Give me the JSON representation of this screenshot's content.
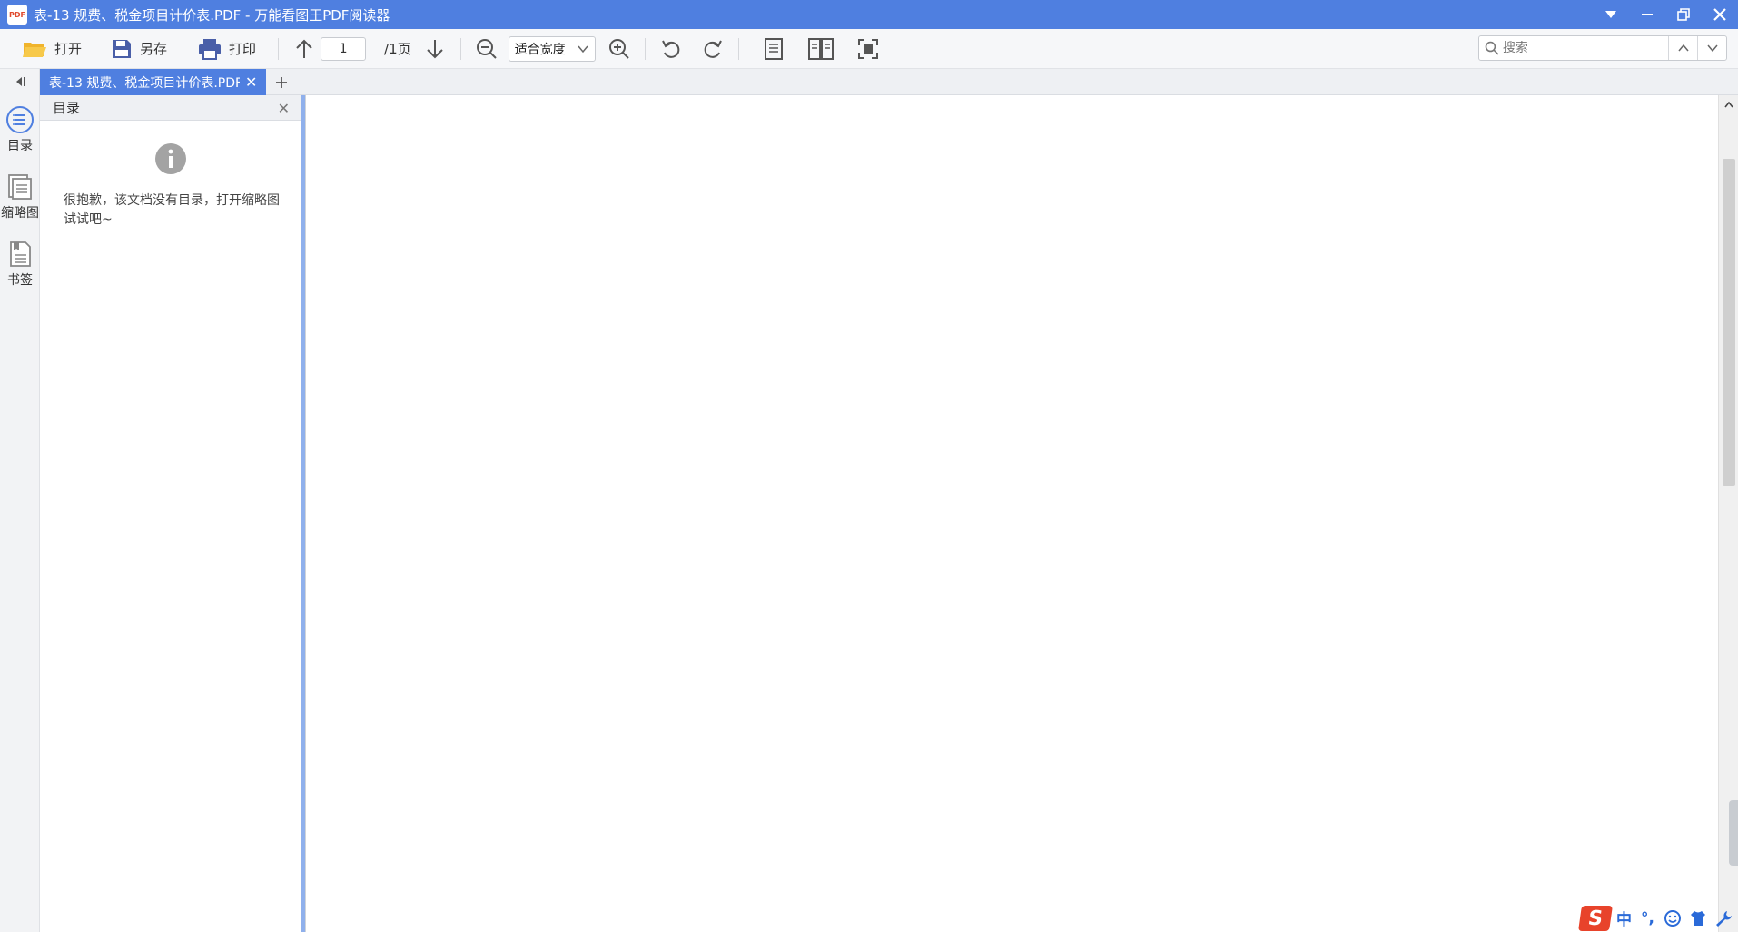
{
  "window": {
    "app_icon_text": "PDF",
    "title": "表-13 规费、税金项目计价表.PDF - 万能看图王PDF阅读器"
  },
  "toolbar": {
    "open_label": "打开",
    "saveas_label": "另存",
    "print_label": "打印",
    "page_current": "1",
    "page_total": "/1页",
    "zoom_mode": "适合宽度",
    "search_placeholder": "搜索"
  },
  "left_strip": {
    "items": [
      {
        "label": "目录",
        "icon": "list-icon"
      },
      {
        "label": "缩略图",
        "icon": "thumbnail-icon"
      },
      {
        "label": "书签",
        "icon": "bookmark-icon"
      }
    ]
  },
  "tabs": [
    {
      "label": "表-13 规费、税金项目计价表.PDF",
      "active": true
    }
  ],
  "outline": {
    "title": "目录",
    "empty_message": "很抱歉，该文档没有目录，打开缩略图试试吧~"
  },
  "ime": {
    "logo": "S",
    "mode": "中",
    "punct": "°,"
  },
  "colors": {
    "titlebar": "#4f7fe0",
    "accent": "#4f7fe0",
    "ime_logo": "#e8432b"
  }
}
